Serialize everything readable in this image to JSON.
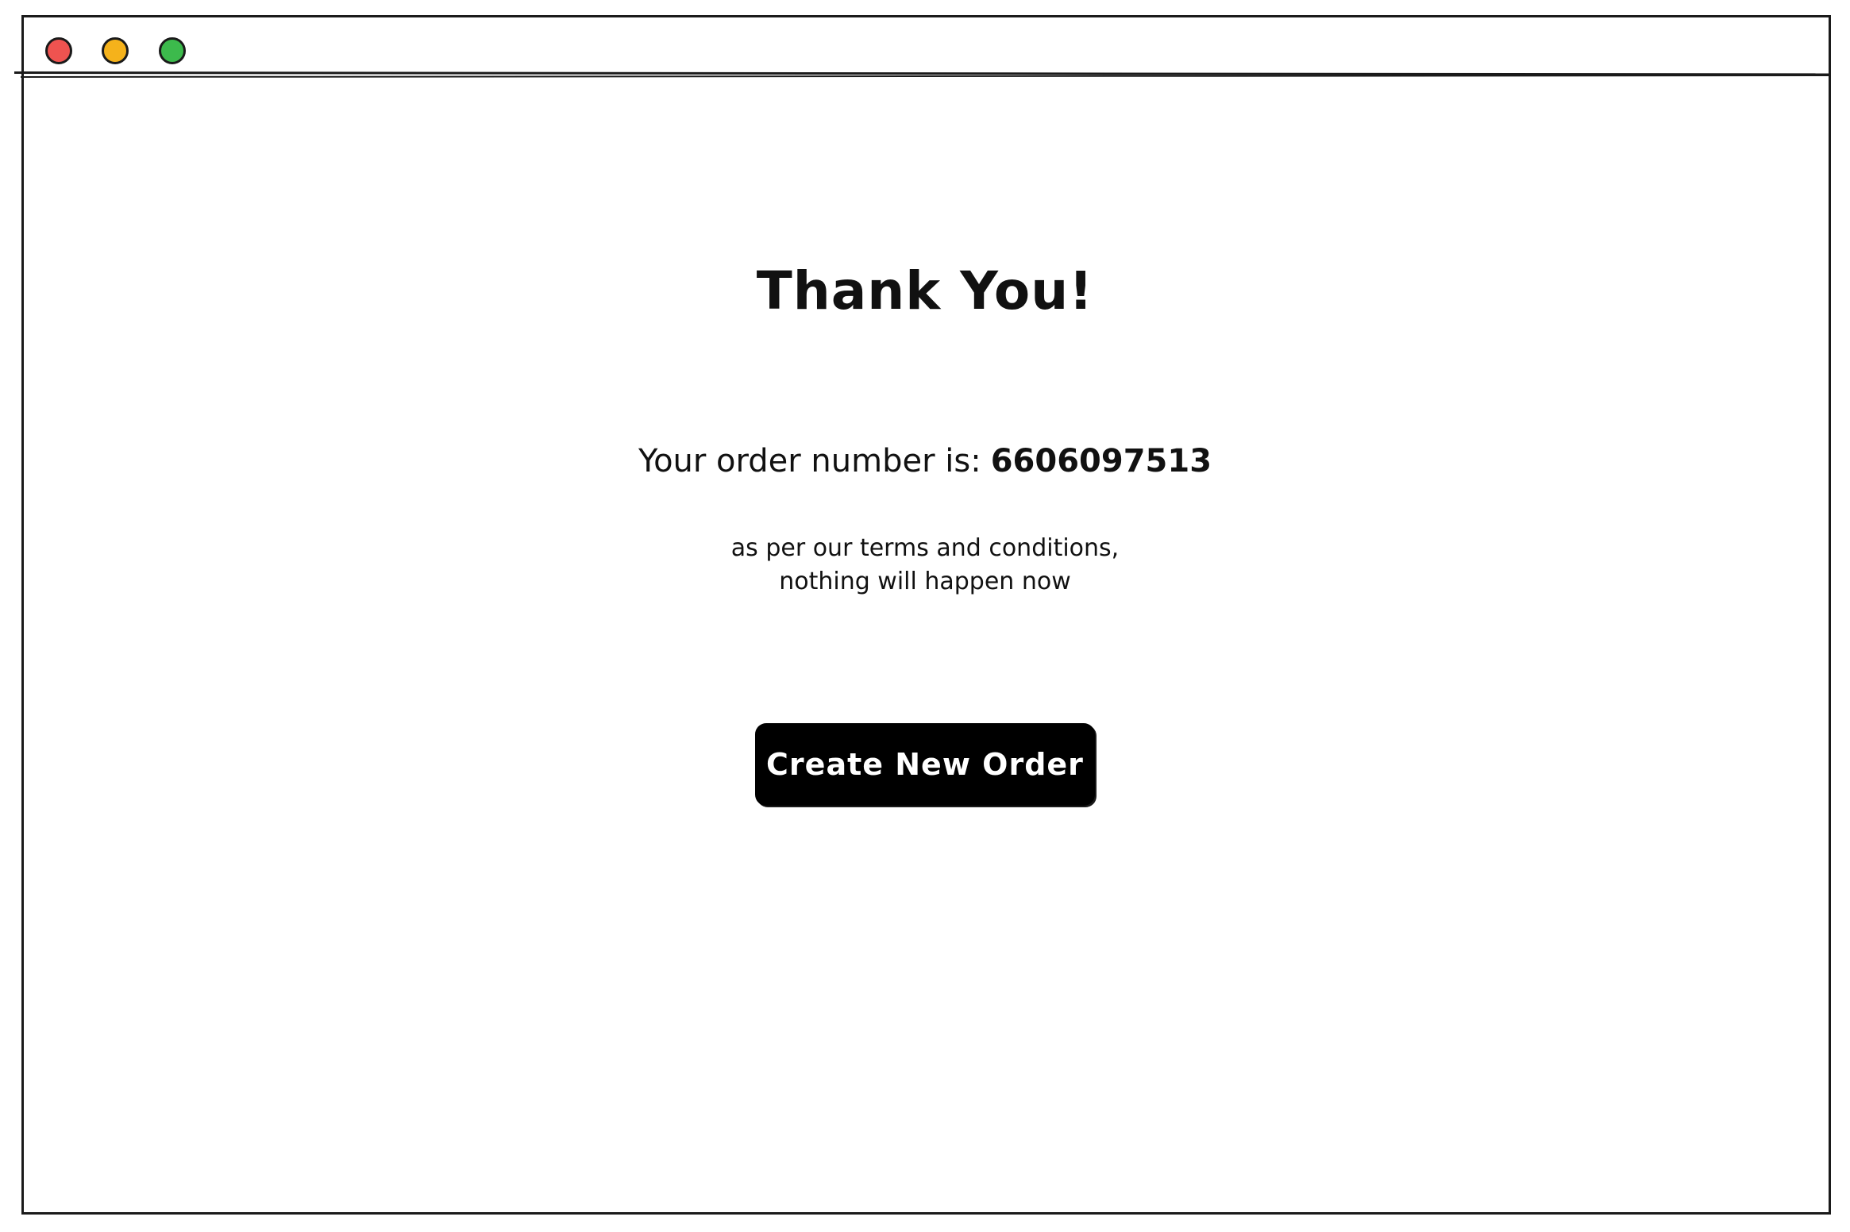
{
  "window": {
    "controls": [
      {
        "name": "close",
        "color": "#ef5350"
      },
      {
        "name": "minimize",
        "color": "#f5b21b"
      },
      {
        "name": "maximize",
        "color": "#3cba4c"
      }
    ]
  },
  "main": {
    "title": "Thank You!",
    "order_label": "Your order number is:",
    "order_number": "6606097513",
    "note_line1": "as per our terms and conditions,",
    "note_line2": "nothing will happen now",
    "cta_label": "Create New Order"
  }
}
